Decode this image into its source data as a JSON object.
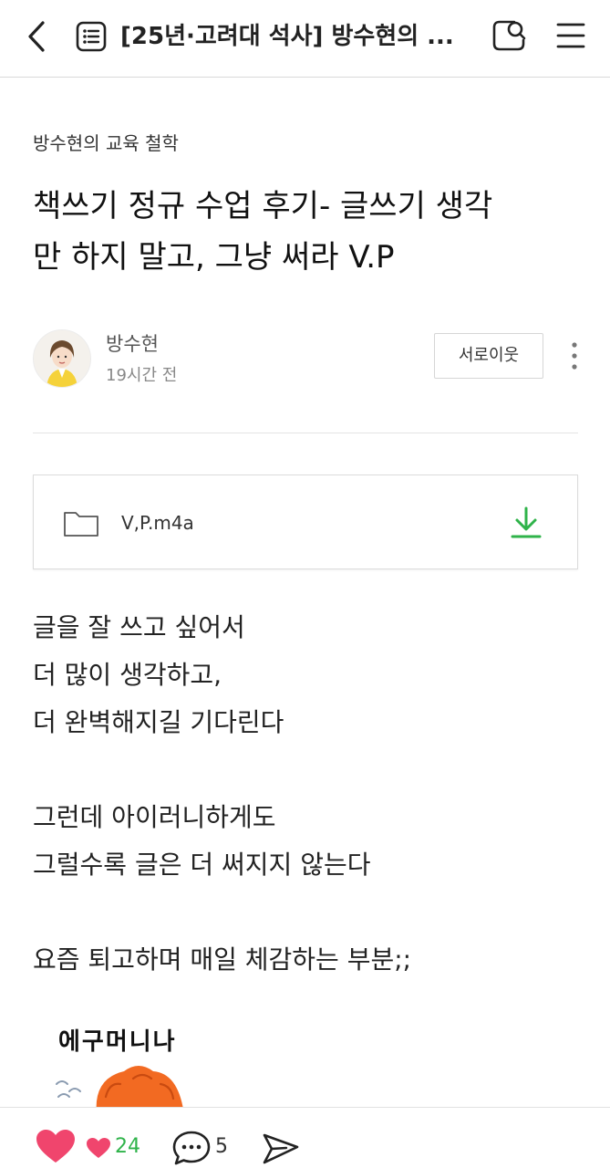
{
  "header": {
    "back_icon": "chevron-left-icon",
    "list_icon": "list-icon",
    "title": "[25년·고려대 석사] 방수현의 ...",
    "search_icon": "blog-search-icon",
    "menu_icon": "hamburger-menu-icon"
  },
  "post": {
    "category": "방수현의 교육 철학",
    "title_line1": "책쓰기 정규 수업 후기- 글쓰기 생각",
    "title_line2": "만 하지 말고, 그냥 써라 V.P",
    "author": "방수현",
    "time": "19시간 전",
    "neighbor_button": "서로이웃",
    "more_icon": "vertical-dots-icon"
  },
  "attachment": {
    "icon": "folder-icon",
    "file_name": "V,P.m4a",
    "download_icon": "download-icon"
  },
  "body": {
    "lines": [
      "글을 잘 쓰고 싶어서",
      "더 많이 생각하고,",
      "더 완벽해지길 기다린다",
      "",
      "그런데 아이러니하게도",
      "그럴수록 글은 더 써지지 않는다",
      "",
      "요즘 퇴고하며 매일 체감하는 부분;;"
    ],
    "sticker_text": "에구머니나"
  },
  "bottom_bar": {
    "like_icon": "heart-icon",
    "like_count": "24",
    "comment_icon": "comment-bubble-icon",
    "comment_count": "5",
    "share_icon": "send-icon"
  },
  "colors": {
    "accent_green": "#2fb34a",
    "like_pink": "#f0456d",
    "sticker_hair": "#f26a22"
  }
}
